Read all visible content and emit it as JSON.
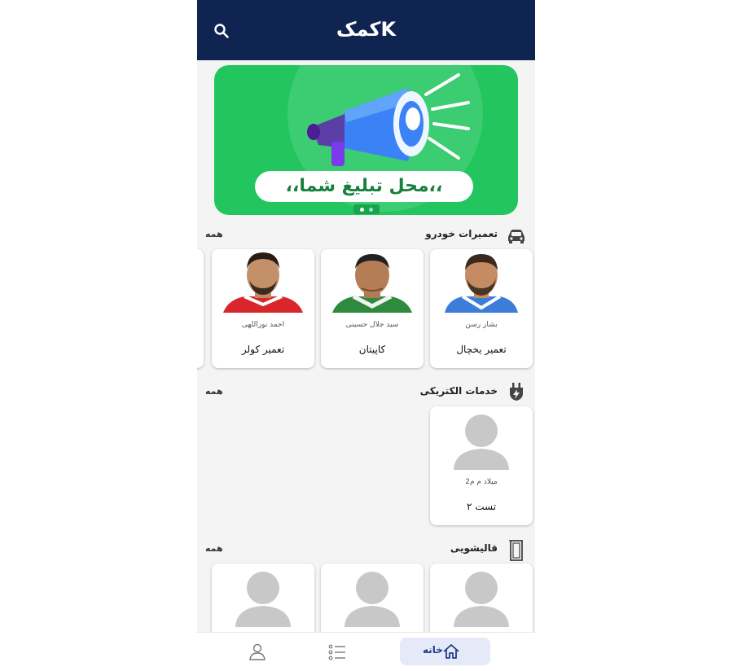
{
  "app": {
    "title": "کمکK"
  },
  "banner": {
    "text": "،،محل تبلیغ شما،،",
    "slides": 2,
    "active_slide": 1
  },
  "sections": [
    {
      "title": "تعمیرات خودرو",
      "more": "همه",
      "icon": "car-icon",
      "cards": [
        {
          "name": "تعمیر یخچال",
          "person": "بشار رسن"
        },
        {
          "name": "کاپیتان",
          "person": "سید جلال حسینی"
        },
        {
          "name": "تعمیر کولر",
          "person": "احمد نوراللهی"
        }
      ]
    },
    {
      "title": "خدمات الکتریکی",
      "more": "همه",
      "icon": "electric-plug-icon",
      "cards": [
        {
          "name": "تست ۲",
          "person": "میلاد م م2"
        }
      ]
    },
    {
      "title": "قالیشویی",
      "more": "همه",
      "icon": "carpet-icon",
      "cards": [
        {
          "name": "",
          "person": ""
        },
        {
          "name": "",
          "person": ""
        },
        {
          "name": "",
          "person": ""
        }
      ]
    }
  ],
  "nav": {
    "home": "خانه"
  },
  "colors": {
    "appbar": "#0f2450",
    "banner": "#22c55e",
    "nav_active_bg": "#e6e9f7",
    "nav_active_text": "#1f3c88"
  }
}
